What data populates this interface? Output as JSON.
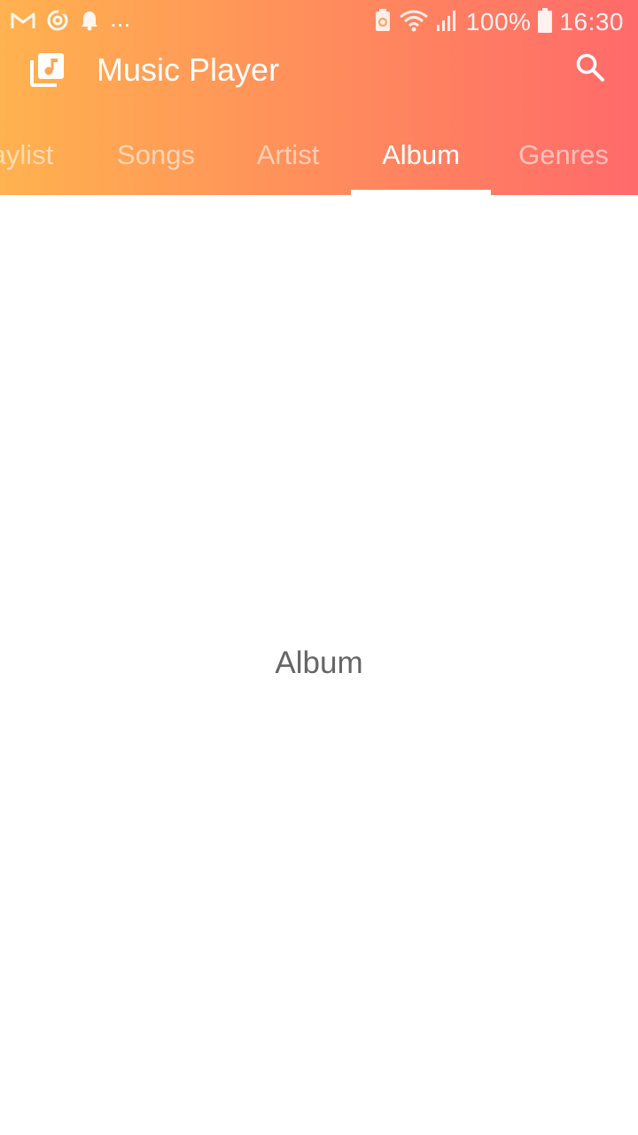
{
  "status_bar": {
    "icons": [
      "gmail-icon",
      "sync-icon",
      "notification-bell-icon",
      "battery-saver-icon",
      "wifi-icon",
      "signal-icon",
      "battery-icon"
    ],
    "more_indicator": "...",
    "battery_percent": "100%",
    "time": "16:30"
  },
  "app_bar": {
    "title": "Music Player",
    "app_icon": "music-library-icon",
    "search_icon": "search-icon"
  },
  "tabs": {
    "items": [
      {
        "label": "aylist"
      },
      {
        "label": "Songs"
      },
      {
        "label": "Artist"
      },
      {
        "label": "Album"
      },
      {
        "label": "Genres"
      }
    ],
    "selected": "Album"
  },
  "content": {
    "placeholder": "Album"
  },
  "colors": {
    "gradient_start": "#ffb24f",
    "gradient_end": "#ff6a6a",
    "content_text": "#666666",
    "background": "#ffffff"
  }
}
